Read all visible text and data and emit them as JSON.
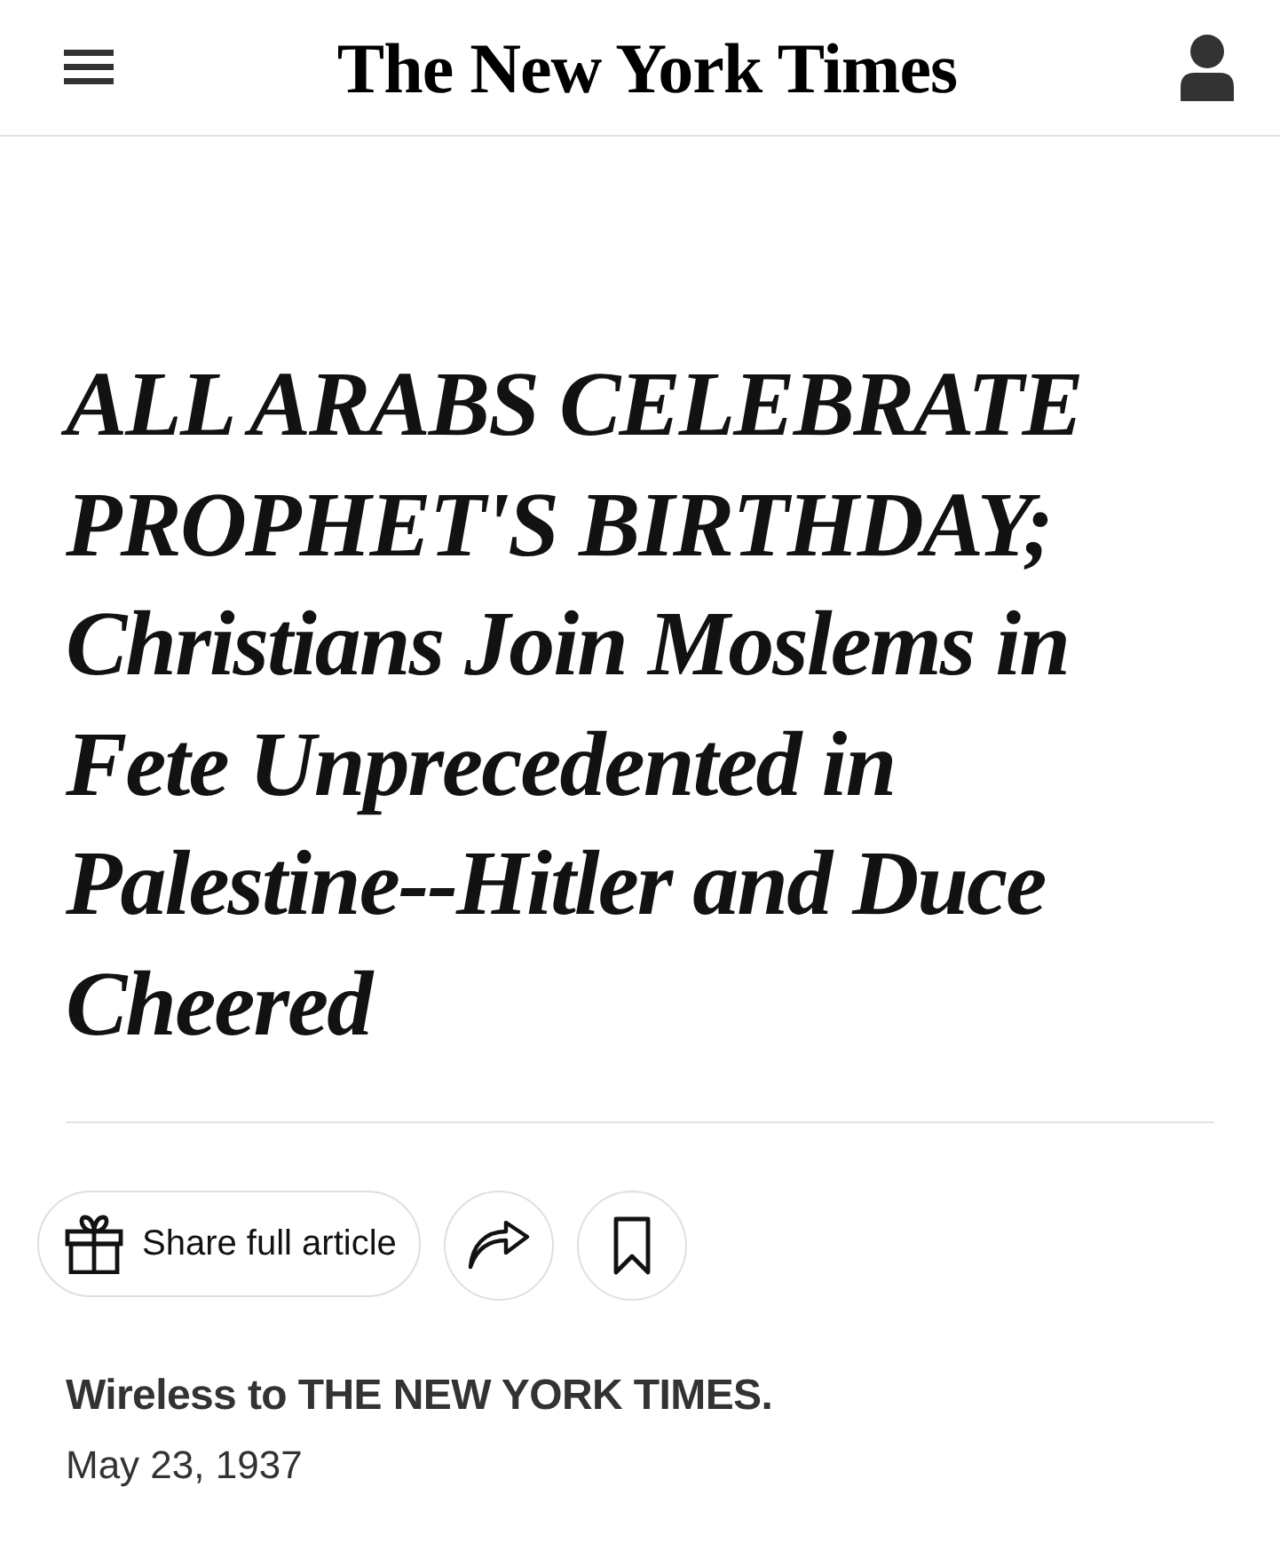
{
  "header": {
    "logo": "The New York Times"
  },
  "headline": "ALL ARABS CELEBRATE PROPHET'S BIRTHDAY; Christians Join Moslems in Fete Unprecedented in Palestine--Hitler and Duce Cheered",
  "share_button": {
    "label": "Share full article"
  },
  "byline": "Wireless to THE NEW YORK TIMES.",
  "date": "May 23, 1937"
}
